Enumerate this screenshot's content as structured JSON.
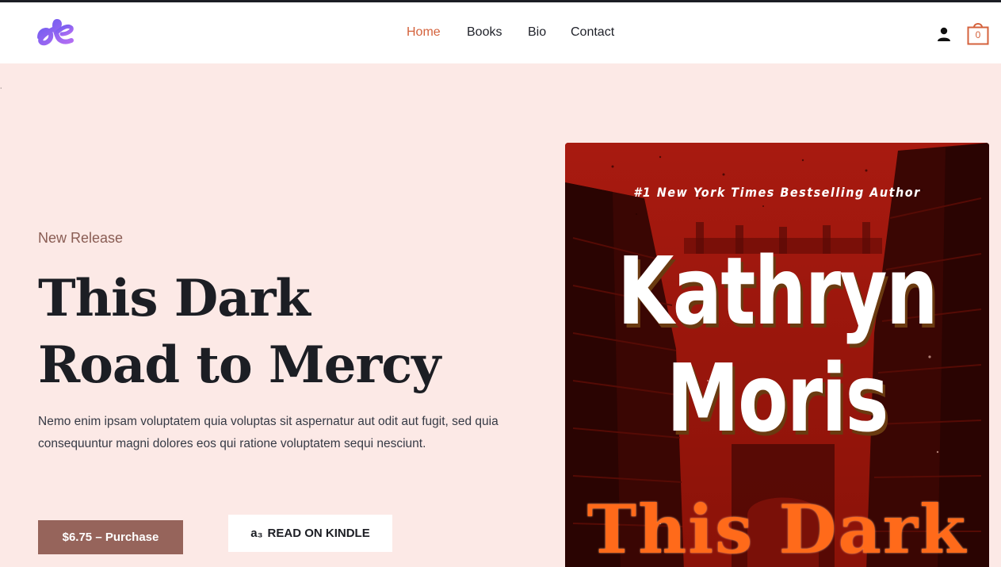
{
  "nav": {
    "items": [
      {
        "label": "Home",
        "active": true
      },
      {
        "label": "Books",
        "active": false
      },
      {
        "label": "Bio",
        "active": false
      },
      {
        "label": "Contact",
        "active": false
      }
    ]
  },
  "header": {
    "cart_count": "0",
    "account_icon": "user-icon",
    "cart_icon": "shopping-bag-icon",
    "logo_icon": "script-k-logo"
  },
  "hero": {
    "eyebrow": "New Release",
    "title_line1": "This Dark",
    "title_line2": "Road to Mercy",
    "description": "Nemo enim ipsam voluptatem quia voluptas sit aspernatur aut odit aut fugit, sed quia consequuntur magni dolores eos qui ratione voluptatem sequi nesciunt.",
    "purchase_label": "$6.75 – Purchase",
    "kindle_label": "READ ON KINDLE",
    "kindle_icon": "amazon-icon"
  },
  "cover": {
    "tagline": "#1 New York Times Bestselling Author",
    "author_first": "Kathryn",
    "author_last": "Moris",
    "title": "This Dark"
  },
  "colors": {
    "accent": "#d4623c",
    "background": "#fce9e6",
    "button": "#96645b",
    "text": "#1c1e24"
  }
}
